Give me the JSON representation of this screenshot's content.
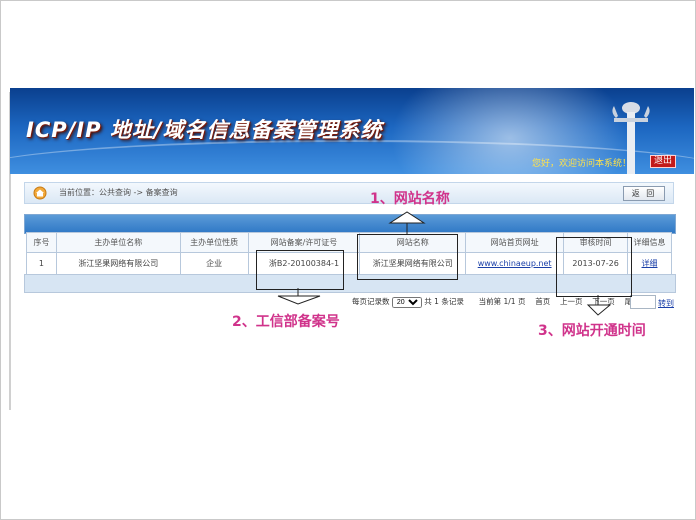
{
  "header": {
    "title": "ICP/IP 地址/域名信息备案管理系统",
    "welcome": "您好，欢迎访问本系统！",
    "exit_label": "退出"
  },
  "breadcrumb": {
    "location": "当前位置：公共查询 -> 备案查询",
    "back_label": "返 回"
  },
  "table": {
    "headers": [
      "序号",
      "主办单位名称",
      "主办单位性质",
      "网站备案/许可证号",
      "网站名称",
      "网站首页网址",
      "审核时间",
      "详细信息"
    ],
    "rows": [
      [
        "1",
        "浙江坚果网络有限公司",
        "企业",
        "浙B2-20100384-1",
        "浙江坚果网络有限公司",
        "www.chinaeup.net",
        "2013-07-26",
        "详细"
      ]
    ]
  },
  "pager": {
    "per_page_label": "每页记录数",
    "per_page_value": "20",
    "total_label": "共 1 条记录",
    "page_info": "当前第 1/1 页",
    "first": "首页",
    "prev": "上一页",
    "next": "下一页",
    "last": "尾页",
    "go_label": "转到"
  },
  "annotations": {
    "site_name": "1、网站名称",
    "icp_number": "2、工信部备案号",
    "open_time": "3、网站开通时间",
    "color": "#d0338b"
  },
  "colors": {
    "banner": "#1c66c0",
    "title_shadow": "#7a1a0a",
    "link": "#1a3fa8"
  }
}
